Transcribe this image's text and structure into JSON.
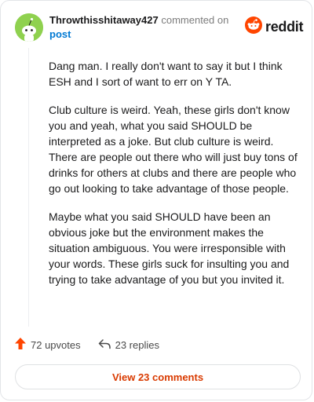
{
  "comment": {
    "username": "Throwthisshitaway427",
    "action_text": "commented on",
    "target": "post",
    "paragraphs": [
      "Dang man. I really don't want to say it but I think ESH and I sort of want to err on Y TA.",
      "Club culture is weird. Yeah, these girls don't know you and yeah, what you said SHOULD be interpreted as a joke. But club culture is weird. There are people out there who will just buy tons of drinks for others at clubs and there are people who go out looking to take advantage of those people.",
      "Maybe what you said SHOULD have been an obvious joke but the environment makes the situation ambiguous. You were irresponsible with your words. These girls suck for insulting you and trying to take advantage of you but you invited it."
    ],
    "upvotes_label": "72 upvotes",
    "replies_label": "23 replies"
  },
  "brand": {
    "wordmark": "reddit",
    "color": "#ff4500"
  },
  "footer": {
    "view_comments_label": "View 23 comments"
  },
  "icons": {
    "avatar": "snoo-avatar-icon",
    "logo": "reddit-logo-icon",
    "upvote": "upvote-arrow-icon",
    "reply": "reply-arrow-icon"
  },
  "colors": {
    "accent": "#d93a00",
    "link": "#0079d3",
    "avatar_bg": "#8fd14f"
  }
}
